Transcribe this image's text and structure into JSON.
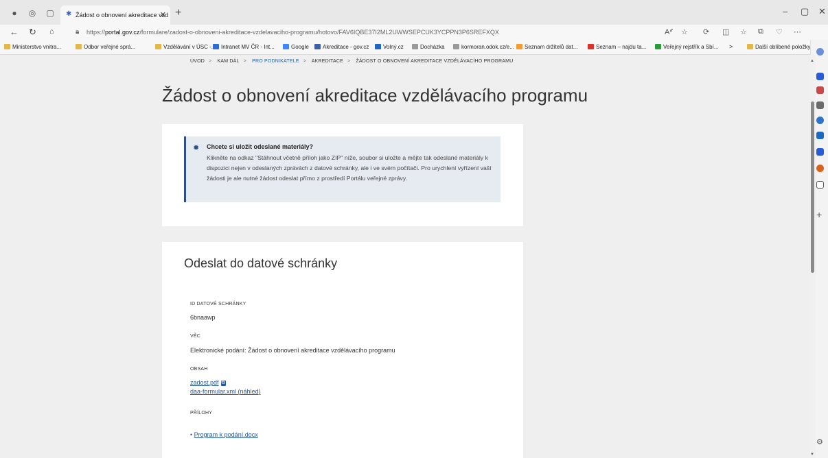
{
  "browser": {
    "tab_title": "Žádost o obnovení akreditace vzd",
    "url_prefix": "https://",
    "url_domain": "portal.gov.cz",
    "url_path": "/formulare/zadost-o-obnoveni-akreditace-vzdelavaciho-programu/hotovo/FAV6IQBE37I2ML2UWWSEPCUK3YCPPN3P6SREFXQX",
    "favorites": [
      {
        "label": "Ministerstvo vnitra...",
        "color": "#e3b74b"
      },
      {
        "label": "Odbor veřejné sprá...",
        "color": "#e3b74b"
      },
      {
        "label": "Vzdělávání v ÚSC -...",
        "color": "#e3b74b"
      },
      {
        "label": "Intranet MV ČR - Int...",
        "color": "#2f6bd1"
      },
      {
        "label": "Google",
        "color": "#4285f4"
      },
      {
        "label": "Akreditace - gov.cz",
        "color": "#3d5fa8"
      },
      {
        "label": "Volný.cz",
        "color": "#1f66c1"
      },
      {
        "label": "Docházka",
        "color": "#9a9a9a"
      },
      {
        "label": "kormoran.odok.cz/e...",
        "color": "#9a9a9a"
      },
      {
        "label": "Seznam držitelů dat...",
        "color": "#f39c34"
      },
      {
        "label": "Seznam – najdu ta...",
        "color": "#d9342b"
      },
      {
        "label": "Veřejný rejstřík a Sbí...",
        "color": "#2b9a3b"
      }
    ],
    "favorites_more": "Další oblíbené položky"
  },
  "breadcrumb": [
    "ÚVOD",
    "KAM DÁL",
    "PRO PODNIKATELE",
    "AKREDITACE",
    "ŽÁDOST O OBNOVENÍ AKREDITACE VZDĚLÁVACÍHO PROGRAMU"
  ],
  "page_title": "Žádost o obnovení akreditace vzdělávacího programu",
  "info": {
    "heading": "Chcete si uložit odeslané materiály?",
    "text": "Klikněte na odkaz \"Stáhnout včetně příloh jako ZIP\" níže, soubor si uložte a mějte tak odeslané materiály k dispozici nejen v odeslaných zprávách z datové schránky, ale i ve svém počítači. Pro urychlení vyřízení vaší žádosti je ale nutné žádost odeslat přímo z prostředí Portálu veřejné zprávy."
  },
  "send": {
    "heading": "Odeslat do datové schránky",
    "id_label": "ID DATOVÉ SCHRÁNKY",
    "id_value": "6bnaawp",
    "subject_label": "VĚC",
    "subject_value": "Elektronické podání: Žádost o obnovení akreditace vzdělávacího programu",
    "content_label": "OBSAH",
    "file1": "zadost.pdf",
    "file2": "daa-formular.xml",
    "preview": "náhled",
    "attach_label": "PŘÍLOHY",
    "attachment": "Program k podání.docx"
  }
}
